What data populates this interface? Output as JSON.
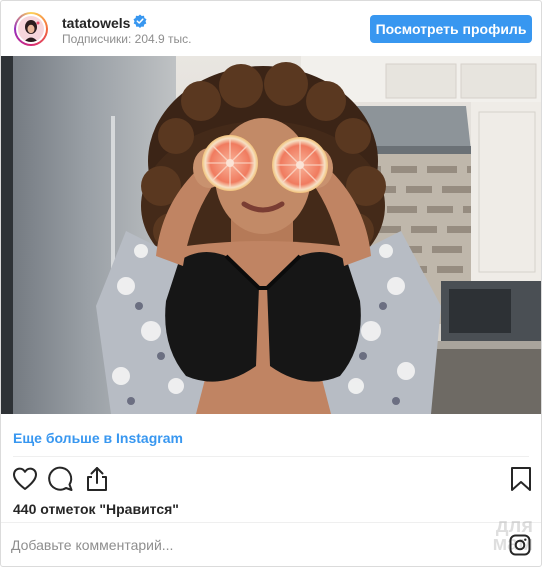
{
  "header": {
    "username": "tatatowels",
    "verified_icon": "verified-badge-icon",
    "followers": "Подписчики: 204.9 тыс.",
    "profile_button": "Посмотреть профиль"
  },
  "post": {
    "image_alt": "Woman holding grapefruit halves over her eyes in a kitchen",
    "more_link": "Еще больше в Instagram",
    "likes": "440 отметок \"Нравится\""
  },
  "actions": {
    "icons": [
      "heart-icon",
      "comment-icon",
      "share-icon",
      "bookmark-icon"
    ]
  },
  "comment": {
    "placeholder": "Добавьте комментарий..."
  },
  "watermark": {
    "line1": "для",
    "line2": "мам"
  },
  "colors": {
    "accent": "#3897f0",
    "text": "#262626",
    "muted": "#8e8e8e",
    "border": "#dbdbdb"
  }
}
